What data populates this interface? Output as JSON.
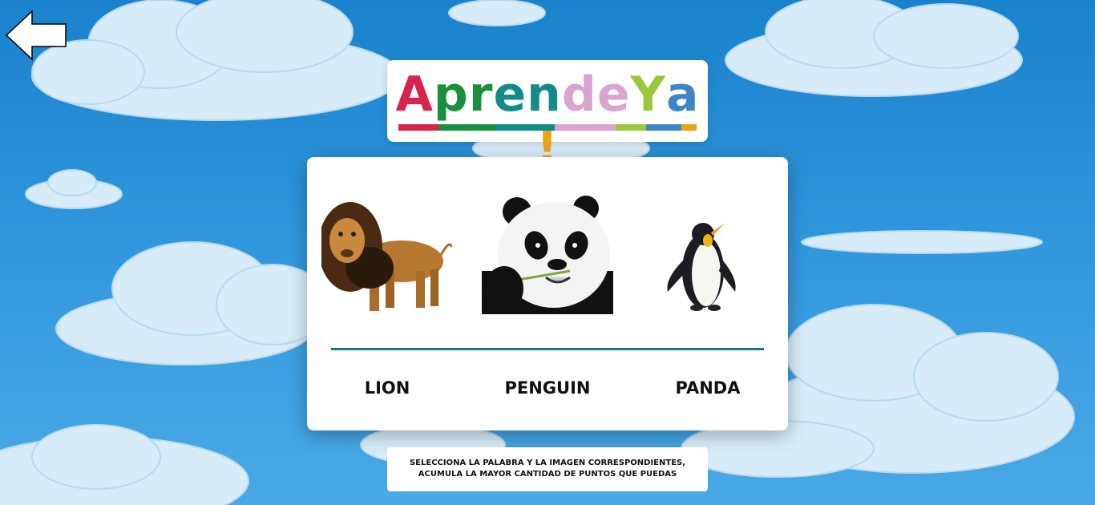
{
  "app": {
    "logo": {
      "letters": [
        {
          "char": "A",
          "color": "#d8234c"
        },
        {
          "char": "p",
          "color": "#1a8f3c"
        },
        {
          "char": "r",
          "color": "#1a8f3c"
        },
        {
          "char": "e",
          "color": "#138b8b"
        },
        {
          "char": "n",
          "color": "#138b8b"
        },
        {
          "char": "d",
          "color": "#d9a4cd"
        },
        {
          "char": "e",
          "color": "#d9a4cd"
        },
        {
          "char": "Y",
          "color": "#9cc63c"
        },
        {
          "char": "a",
          "color": "#3f86c7"
        },
        {
          "char": "!",
          "color": "#e8a514"
        }
      ],
      "stripe_colors": [
        "#d8234c",
        "#1a8f3c",
        "#138b8b",
        "#d9a4cd",
        "#9cc63c",
        "#3f86c7",
        "#e8a514"
      ]
    }
  },
  "navigation": {
    "back_icon": "left-arrow-icon"
  },
  "game": {
    "images": [
      {
        "animal": "lion",
        "icon": "lion-image"
      },
      {
        "animal": "panda",
        "icon": "panda-image"
      },
      {
        "animal": "penguin",
        "icon": "penguin-image"
      }
    ],
    "words": [
      "LION",
      "PENGUIN",
      "PANDA"
    ],
    "divider_color": "#137f83"
  },
  "instructions": {
    "line1": "SELECCIONA LA PALABRA Y LA IMAGEN CORRESPONDIENTES,",
    "line2": "ACUMULA LA MAYOR CANTIDAD DE PUNTOS QUE PUEDAS"
  }
}
